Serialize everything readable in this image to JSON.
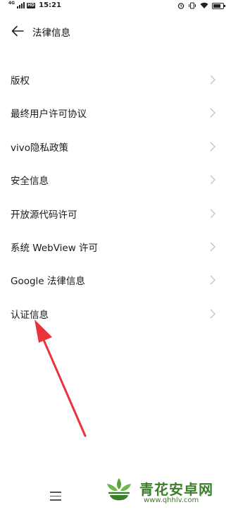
{
  "status_bar": {
    "network": "4G",
    "hd": "HD",
    "time": "15:21"
  },
  "header": {
    "title": "法律信息"
  },
  "items": [
    {
      "label": "版权"
    },
    {
      "label": "最终用户许可协议"
    },
    {
      "label": "vivo隐私政策"
    },
    {
      "label": "安全信息"
    },
    {
      "label": "开放源代码许可"
    },
    {
      "label": "系统 WebView 许可"
    },
    {
      "label": "Google 法律信息"
    },
    {
      "label": "认证信息"
    }
  ],
  "colors": {
    "annotation_arrow": "#e8333a",
    "watermark_green": "#3a7e2b",
    "chevron": "#c4c4c4"
  },
  "icons": [
    "back-arrow-icon",
    "chevron-right-icon",
    "alarm-icon",
    "vibrate-icon",
    "wifi-icon",
    "battery-icon",
    "menu-icon"
  ],
  "watermark": {
    "name": "青花安卓网",
    "url": "www.qhhlv.com"
  }
}
